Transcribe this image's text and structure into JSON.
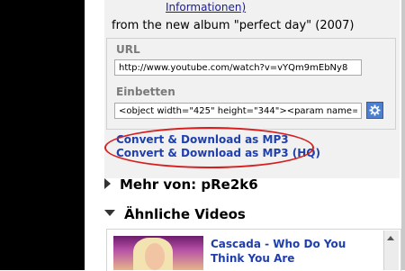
{
  "info": {
    "link_label": "Informationen)"
  },
  "description": "from the new album \"perfect day\" (2007)",
  "share": {
    "url_label": "URL",
    "url_value": "http://www.youtube.com/watch?v=vYQm9mEbNy8",
    "embed_label": "Einbetten",
    "embed_value": "<object width=\"425\" height=\"344\"><param name=\"m",
    "settings_icon": "gear-icon"
  },
  "convert": {
    "mp3_label": "Convert & Download as MP3",
    "mp3_hq_label": "Convert & Download as MP3 (HQ)",
    "highlight_color": "#d62020"
  },
  "sections": {
    "more_from": "Mehr von: pRe2k6",
    "similar": "Ähnliche Videos"
  },
  "related": {
    "title": "Cascada - Who Do You Think You Are"
  },
  "colors": {
    "link": "#1f3fae",
    "panel": "#f1f1f1"
  }
}
